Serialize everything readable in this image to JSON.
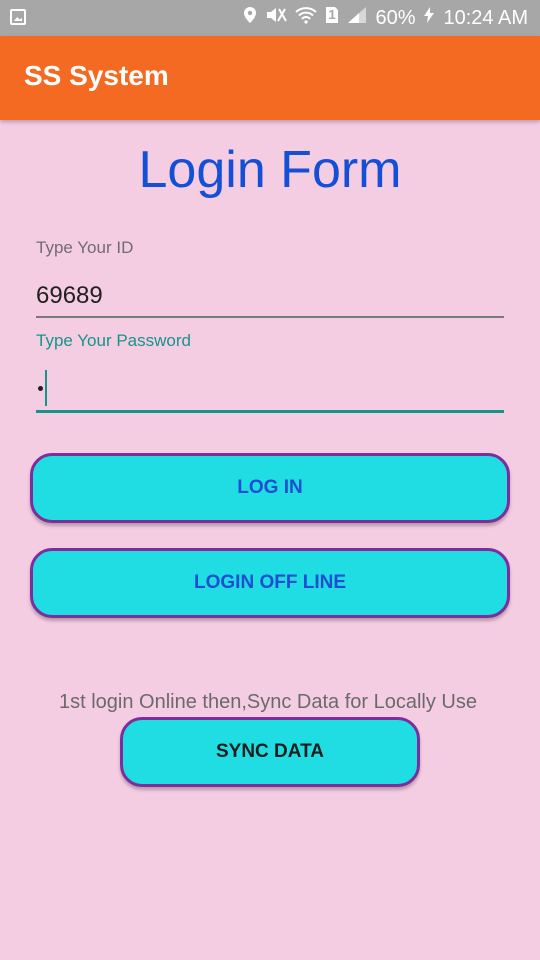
{
  "status_bar": {
    "battery": "60%",
    "time": "10:24 AM",
    "sim_slot": "1",
    "icons": [
      "gallery-icon",
      "location-pin-icon",
      "mute-icon",
      "wifi-icon",
      "sim-icon",
      "signal-icon",
      "charging-bolt-icon"
    ]
  },
  "app_bar": {
    "title": "SS System",
    "color": "#f56a22"
  },
  "form": {
    "heading": "Login Form",
    "id_label": "Type Your ID",
    "id_value": "69689",
    "password_label": "Type Your Password",
    "password_value_masked": "•",
    "accent_color": "#14958a"
  },
  "buttons": {
    "login": "LOG IN",
    "login_offline": "LOGIN OFF LINE",
    "sync": "SYNC DATA",
    "fill_color": "#1fdde3",
    "border_color": "#7d2e9c"
  },
  "note": "1st login Online then,Sync Data for Locally Use",
  "background_color": "#f5cde3"
}
